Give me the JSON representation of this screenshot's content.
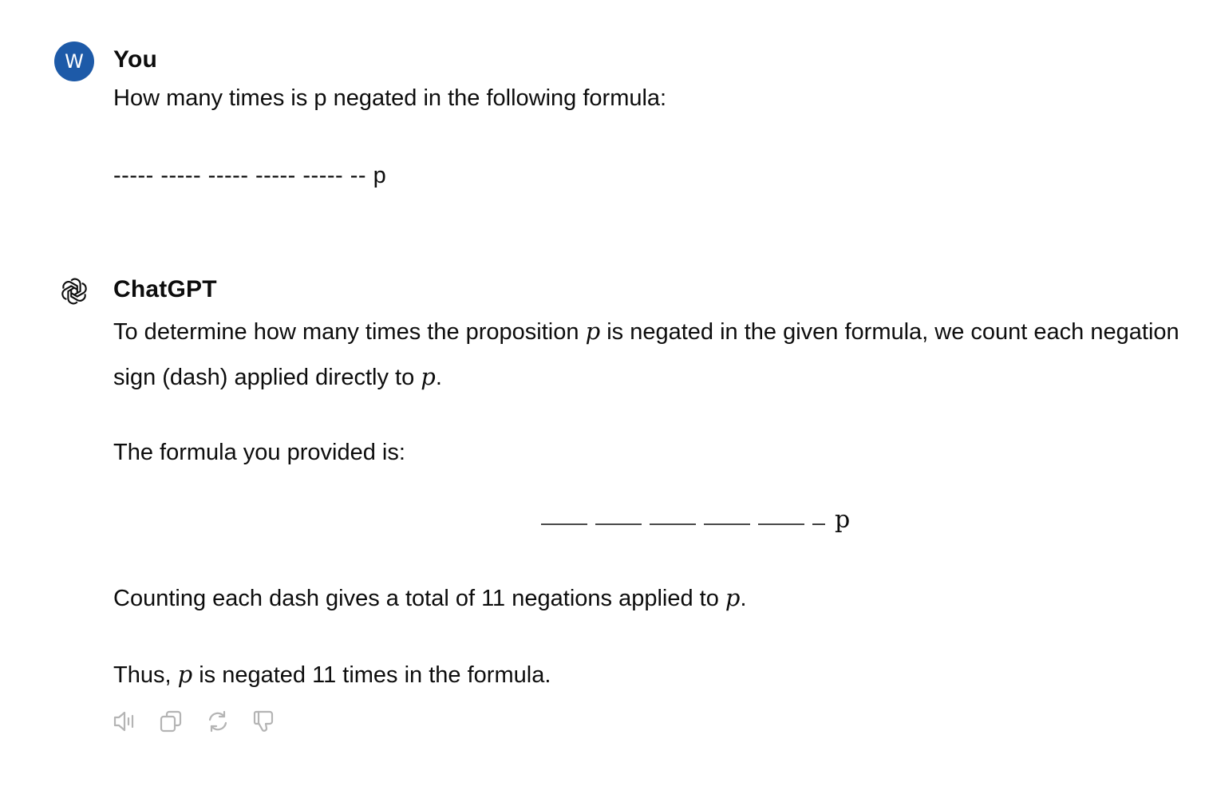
{
  "user_message": {
    "avatar_letter": "W",
    "author": "You",
    "question": "How many times is p negated in the following formula:",
    "formula": "----- ----- ----- ----- ----- -- p"
  },
  "assistant_message": {
    "author": "ChatGPT",
    "para1_a": "To determine how many times the proposition ",
    "para1_var1": "p",
    "para1_b": " is negated in the given formula, we count each negation sign (dash) applied directly to ",
    "para1_var2": "p",
    "para1_c": ".",
    "para2": "The formula you provided is:",
    "display_formula_var": "p",
    "para3_a": "Counting each dash gives a total of 11 negations applied to ",
    "para3_var": "p",
    "para3_b": ".",
    "para4_a": "Thus, ",
    "para4_var": "p",
    "para4_b": " is negated 11 times in the formula."
  },
  "actions": [
    {
      "icon": "speaker-icon"
    },
    {
      "icon": "copy-icon"
    },
    {
      "icon": "regenerate-icon"
    },
    {
      "icon": "thumbs-down-icon"
    }
  ],
  "colors": {
    "avatar_bg": "#1d5aa8",
    "text": "#0d0d0d",
    "icon": "#b4b4b4"
  }
}
